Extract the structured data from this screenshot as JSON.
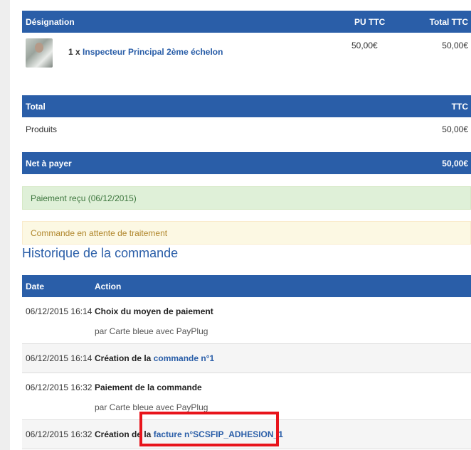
{
  "order_table": {
    "headers": {
      "designation": "Désignation",
      "unit_price": "PU TTC",
      "total": "Total TTC"
    },
    "item": {
      "qty": "1 x",
      "name": "Inspecteur Principal 2ème échelon",
      "unit_price": "50,00€",
      "total": "50,00€"
    }
  },
  "totals": {
    "header_label": "Total",
    "header_col": "TTC",
    "products_label": "Produits",
    "products_value": "50,00€",
    "net_label": "Net à payer",
    "net_value": "50,00€"
  },
  "alerts": {
    "payment": "Paiement reçu (06/12/2015)",
    "status": "Commande en attente de traitement"
  },
  "history": {
    "title": "Historique de la commande",
    "headers": {
      "date": "Date",
      "action": "Action"
    },
    "rows": [
      {
        "date": "06/12/2015 16:14",
        "action": "Choix du moyen de paiement",
        "sub": "par Carte bleue avec PayPlug"
      },
      {
        "date": "06/12/2015 16:14",
        "action_prefix": "Création de la",
        "action_link": "commande n°1"
      },
      {
        "date": "06/12/2015 16:32",
        "action": "Paiement de la commande",
        "sub": "par Carte bleue avec PayPlug"
      },
      {
        "date": "06/12/2015 16:32",
        "action_prefix": "Création de la",
        "action_link": "facture n°SCSFIP_ADHESION_1"
      }
    ]
  },
  "colors": {
    "primary": "#2a5ea8",
    "highlight": "#e8141b",
    "success_bg": "#dff0d8",
    "warning_bg": "#fcf8e3"
  }
}
